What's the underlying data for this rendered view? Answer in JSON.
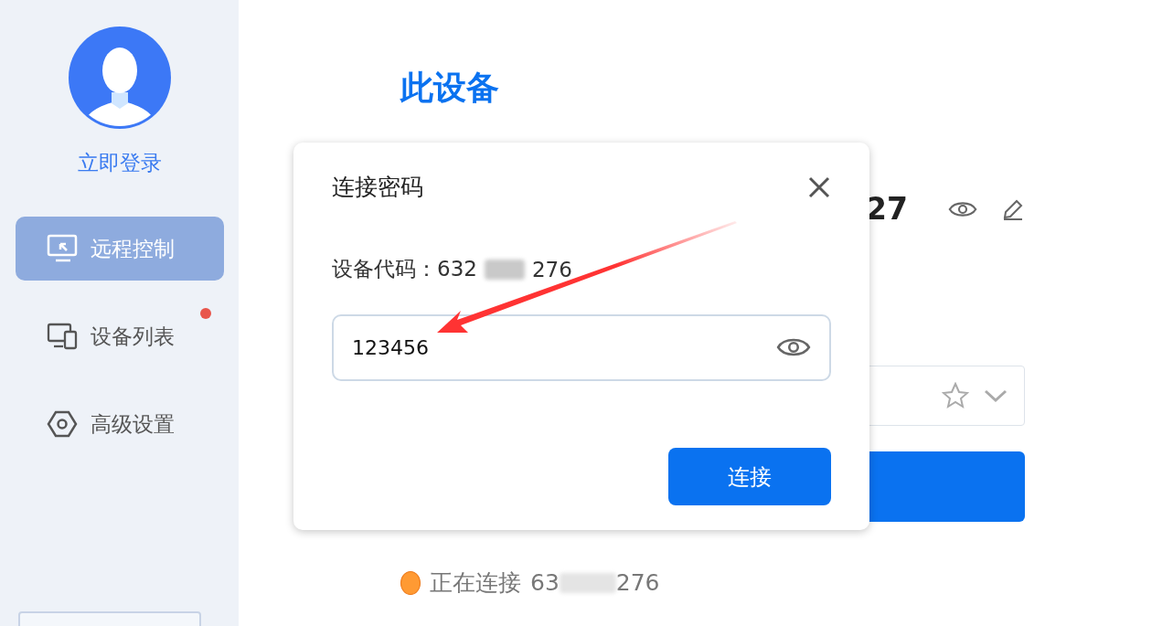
{
  "sidebar": {
    "login_link": "立即登录",
    "nav": [
      {
        "label": "远程控制",
        "kind": "monitor",
        "selected": true,
        "badge": false
      },
      {
        "label": "设备列表",
        "kind": "devices",
        "selected": false,
        "badge": true
      },
      {
        "label": "高级设置",
        "kind": "settings",
        "selected": false,
        "badge": false
      }
    ]
  },
  "main": {
    "title": "此设备",
    "device_id_fragment": "27",
    "status": {
      "label": "正在连接",
      "code_start": "63",
      "code_end": "276"
    }
  },
  "dialog": {
    "title": "连接密码",
    "device_code_label": "设备代码：",
    "code_start": "632",
    "code_end": "276",
    "password": "123456",
    "button": "连接"
  }
}
